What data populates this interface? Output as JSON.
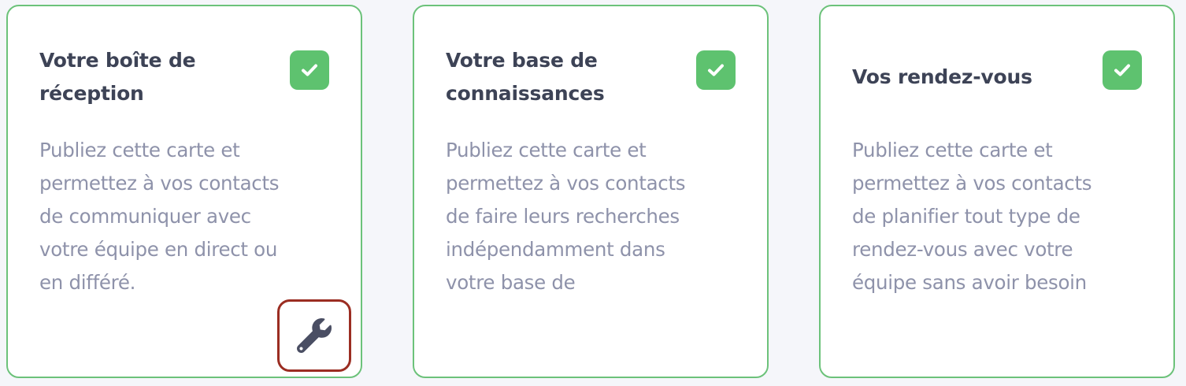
{
  "cards": [
    {
      "title": "Votre boîte de réception",
      "description_lines": [
        "Publiez cette carte et",
        "permettez à vos contacts",
        "de communiquer avec",
        "votre équipe en direct ou",
        "en différé."
      ],
      "status_icon": "check-icon",
      "action_icon": "wrench-icon"
    },
    {
      "title": "Votre base de connaissances",
      "description_lines": [
        "Publiez cette carte et",
        "permettez à vos contacts",
        "de faire leurs recherches",
        "indépendamment dans",
        "votre base de"
      ],
      "status_icon": "check-icon"
    },
    {
      "title": "Vos rendez-vous",
      "description_lines": [
        "Publiez cette carte et",
        "permettez à vos contacts",
        "de planifier tout type de",
        "rendez-vous avec votre",
        "équipe sans avoir besoin"
      ],
      "status_icon": "check-icon"
    }
  ],
  "colors": {
    "background": "#f5f6fa",
    "card_border": "#6cc27a",
    "check_badge": "#5ec26f",
    "title_text": "#3d4356",
    "description_text": "#8e92aa",
    "highlight_border": "#9b2d22",
    "wrench_icon": "#4a4e63"
  }
}
